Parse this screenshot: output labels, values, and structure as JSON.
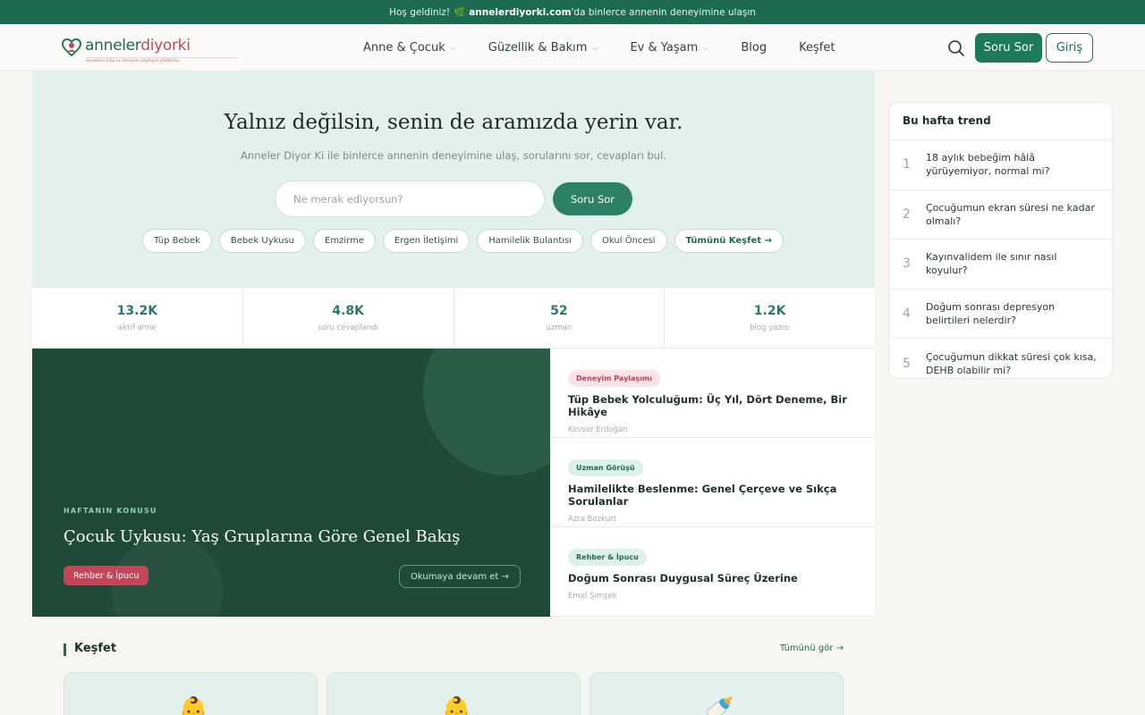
{
  "topbar": {
    "prefix": "Hoş geldiniz!",
    "icon": "🌿",
    "site": "annelerdiyorki.com",
    "suffix": "'da binlerce annenin deneyimine ulaşın"
  },
  "logo": {
    "part1": "anneler",
    "part2": "diyorki",
    "tagline": "annelerin bilgi ve deneyim paylaşım platformu"
  },
  "nav": [
    {
      "label": "Anne & Çocuk",
      "chevron": true
    },
    {
      "label": "Güzellik & Bakım",
      "chevron": true
    },
    {
      "label": "Ev & Yaşam",
      "chevron": true
    },
    {
      "label": "Blog",
      "chevron": false
    },
    {
      "label": "Keşfet",
      "chevron": false
    }
  ],
  "header": {
    "ask_label": "Soru Sor",
    "login_label": "Giriş"
  },
  "hero": {
    "title": "Yalnız değilsin, senin de aramızda yerin var.",
    "subtitle": "Anneler Diyor Ki ile binlerce annenin deneyimine ulaş, sorularını sor, cevapları bul.",
    "input_placeholder": "Ne merak ediyorsun?",
    "button_label": "Soru Sor",
    "chips": [
      "Tüp Bebek",
      "Bebek Uykusu",
      "Emzirme",
      "Ergen İletişimi",
      "Hamilelik Bulantısı",
      "Okul Öncesi"
    ],
    "all_chip": "Tümünü Keşfet →"
  },
  "stats": [
    {
      "value": "13.2K",
      "label": "aktif anne"
    },
    {
      "value": "4.8K",
      "label": "soru cevaplandı"
    },
    {
      "value": "52",
      "label": "uzman"
    },
    {
      "value": "1.2K",
      "label": "blog yazısı"
    }
  ],
  "feature": {
    "kicker": "HAFTANIN KONUSU",
    "title": "Çocuk Uykusu: Yaş Gruplarına Göre Genel Bakış",
    "badge": "Rehber & İpucu",
    "read_more": "Okumaya devam et →"
  },
  "articles": [
    {
      "tag": "Deneyim Paylaşımı",
      "tag_style": "pink",
      "title": "Tüp Bebek Yolculuğum: Üç Yıl, Dört Deneme, Bir Hikâye",
      "author": "Kevser Erdoğan"
    },
    {
      "tag": "Uzman Görüşü",
      "tag_style": "green",
      "title": "Hamilelikte Beslenme: Genel Çerçeve ve Sıkça Sorulanlar",
      "author": "Azra Bozkurt"
    },
    {
      "tag": "Rehber & İpucu",
      "tag_style": "green",
      "title": "Doğum Sonrası Duygusal Süreç Üzerine",
      "author": "Emel Şimşek"
    }
  ],
  "explore": {
    "title": "Keşfet",
    "see_all": "Tümünü gör →",
    "cards": [
      {
        "icon": "👶"
      },
      {
        "icon": "👶"
      },
      {
        "icon": "🍼"
      }
    ]
  },
  "trend": {
    "title": "Bu hafta trend",
    "items": [
      {
        "num": "1",
        "text": "18 aylık bebeğim hâlâ yürüyemiyor, normal mi?"
      },
      {
        "num": "2",
        "text": "Çocuğumun ekran süresi ne kadar olmalı?"
      },
      {
        "num": "3",
        "text": "Kayınvalidem ile sınır nasıl koyulur?"
      },
      {
        "num": "4",
        "text": "Doğum sonrası depresyon belirtileri nelerdir?"
      },
      {
        "num": "5",
        "text": "Çocuğumun dikkat süresi çok kısa, DEHB olabilir mi?"
      }
    ]
  },
  "colors": {
    "brand": "#1e6b53",
    "accent_pink": "#c0485d",
    "hero_bg": "#e3f1ec",
    "feature_bg": "#1f4a37"
  }
}
